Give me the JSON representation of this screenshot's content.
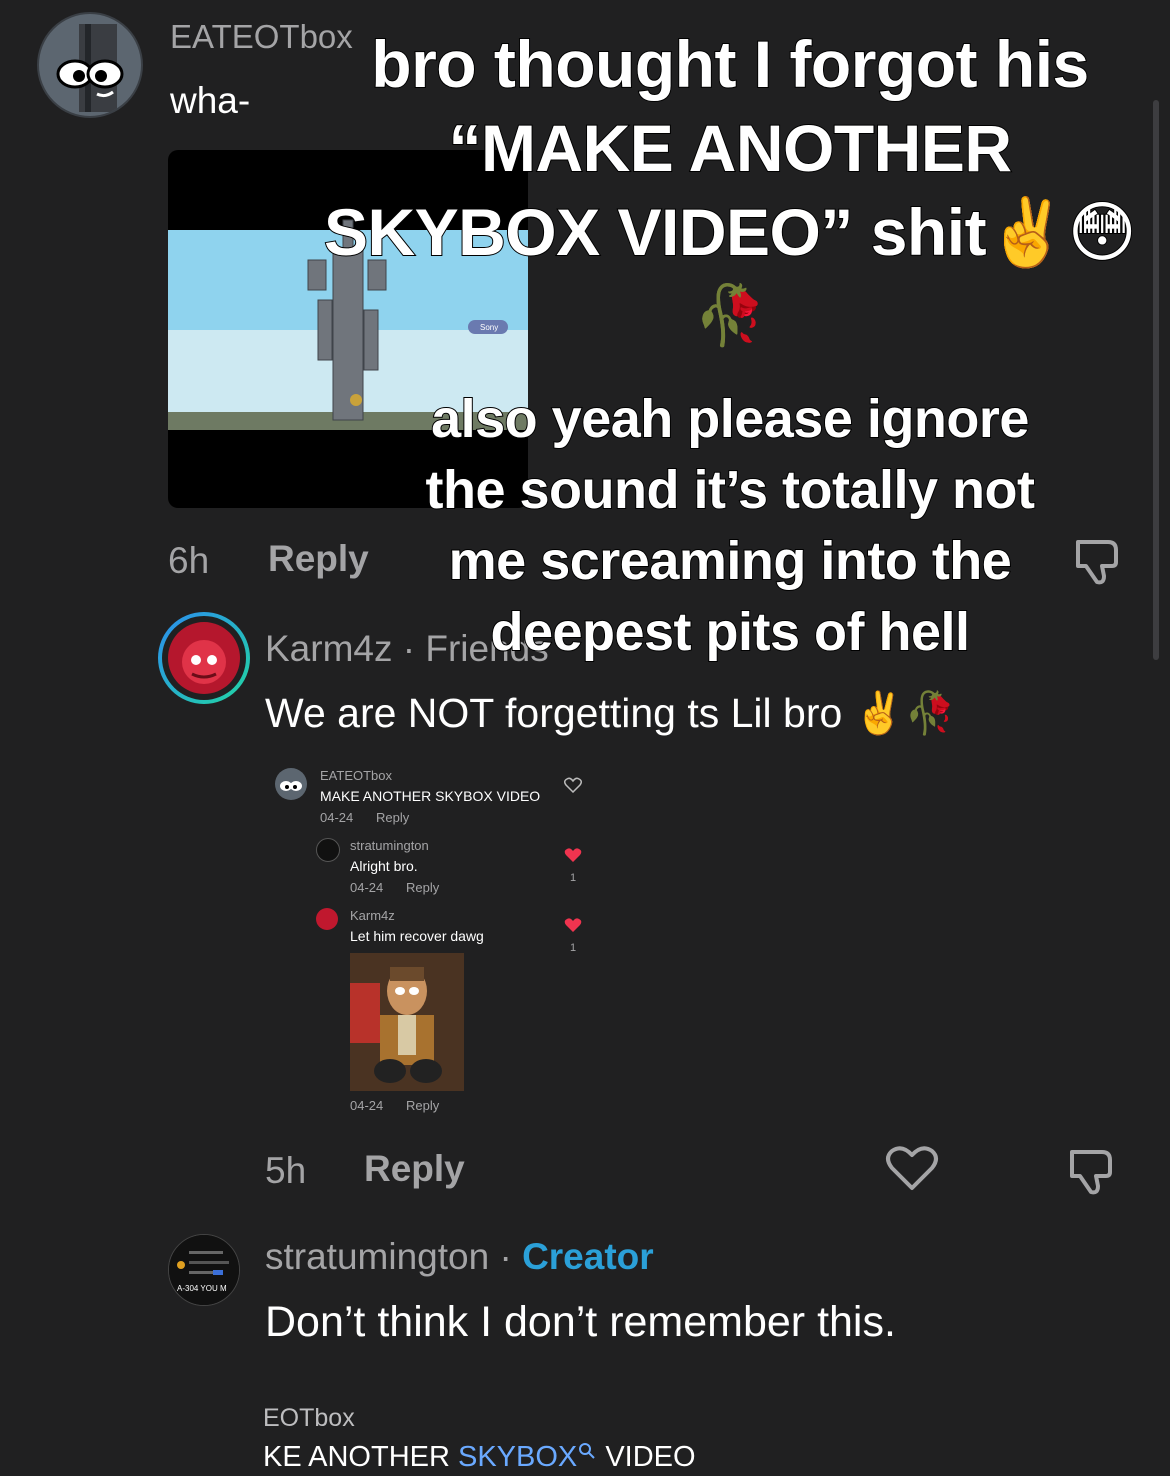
{
  "comment1": {
    "username": "EATEOTbox",
    "text": "wha-",
    "time": "6h",
    "reply_label": "Reply"
  },
  "overlay": {
    "line1": "bro thought I forgot his",
    "line2": "“MAKE ANOTHER",
    "line3": "SKYBOX VIDEO” shit✌️😳",
    "line4": "🥀",
    "line5": "also yeah please ignore",
    "line6": "the sound it’s totally not",
    "line7": "me screaming into the",
    "line8": "deepest pits of hell"
  },
  "comment2": {
    "username": "Karm4z",
    "separator": " · ",
    "tag": "Friends",
    "text": "We are NOT forgetting ts Lil bro ✌️🥀",
    "time": "5h",
    "reply_label": "Reply"
  },
  "screenshot": {
    "thread": [
      {
        "username": "EATEOTbox",
        "text": "MAKE ANOTHER SKYBOX VIDEO",
        "date": "04-24",
        "reply_label": "Reply",
        "likes": ""
      },
      {
        "username": "stratumington",
        "text": "Alright bro.",
        "date": "04-24",
        "reply_label": "Reply",
        "likes": "1"
      },
      {
        "username": "Karm4z",
        "text": "Let him recover dawg",
        "date": "04-24",
        "reply_label": "Reply",
        "likes": "1"
      }
    ],
    "thumbnail_text": "Sony"
  },
  "comment3": {
    "username": "stratumington",
    "separator": " · ",
    "tag": "Creator",
    "text": "Don’t think I don’t remember this.",
    "avatar_lines": [
      "A-304 YOU M"
    ]
  },
  "comment4_partial": {
    "username": "EOTbox",
    "text_before": "KE ANOTHER ",
    "link_text": "SKYBOX",
    "text_after": " VIDEO"
  },
  "colors": {
    "background": "#202021",
    "muted": "#a4a4a6",
    "creator": "#2ba0d8",
    "link": "#6aa9ff",
    "heart": "#f0344f"
  }
}
